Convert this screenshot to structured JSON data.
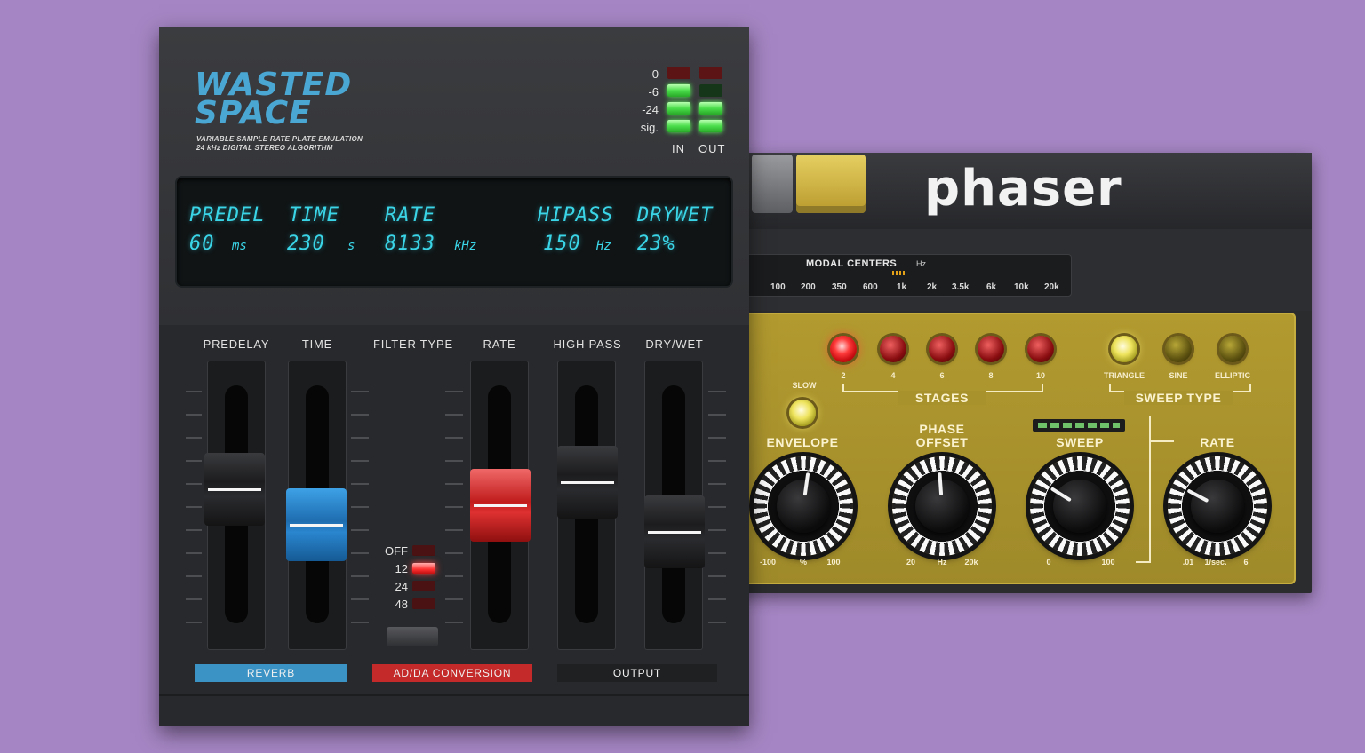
{
  "phaser": {
    "title": "phaser",
    "modal_centers": {
      "title": "MODAL CENTERS",
      "unit": "Hz",
      "freqs": [
        "100",
        "200",
        "350",
        "600",
        "1k",
        "2k",
        "3.5k",
        "6k",
        "10k",
        "20k"
      ]
    },
    "stages": {
      "label": "STAGES",
      "options": [
        "2",
        "4",
        "6",
        "8",
        "10"
      ],
      "selected": "2"
    },
    "sweep_type": {
      "label": "SWEEP TYPE",
      "options": [
        "TRIANGLE",
        "SINE",
        "ELLIPTIC"
      ],
      "selected": "TRIANGLE"
    },
    "slow_label": "SLOW",
    "envelope": {
      "label": "ENVELOPE",
      "min": "-100",
      "unit": "%",
      "max": "100"
    },
    "phase_offset": {
      "label_1": "PHASE",
      "label_2": "OFFSET",
      "min": "20",
      "unit": "Hz",
      "max": "20k"
    },
    "sweep": {
      "label": "SWEEP",
      "min": "0",
      "max": "100"
    },
    "rate": {
      "label": "RATE",
      "min": ".01",
      "unit": "1/sec.",
      "max": "6"
    }
  },
  "wasted_space": {
    "logo_line1": "WASTED",
    "logo_line2": "SPACE",
    "subtitle_1": "VARIABLE SAMPLE RATE PLATE EMULATION",
    "subtitle_2": "24 kHz DIGITAL STEREO ALGORITHM",
    "meter": {
      "levels": [
        "0",
        "-6",
        "-24",
        "sig."
      ],
      "in_label": "IN",
      "out_label": "OUT"
    },
    "display": {
      "headers": [
        "PREDEL",
        "TIME",
        "RATE",
        "HIPASS",
        "DRYWET"
      ],
      "values": [
        {
          "value": "60",
          "unit": "ms"
        },
        {
          "value": "230",
          "unit": "s"
        },
        {
          "value": "8133",
          "unit": "kHz"
        },
        {
          "value": "150",
          "unit": "Hz"
        },
        {
          "value": "23%",
          "unit": ""
        }
      ]
    },
    "sliders": {
      "predelay": "PREDELAY",
      "time": "TIME",
      "filter_type": "FILTER TYPE",
      "rate": "RATE",
      "high_pass": "HIGH PASS",
      "dry_wet": "DRY/WET"
    },
    "filter_options": [
      "OFF",
      "12",
      "24",
      "48"
    ],
    "filter_selected": "12",
    "sections": {
      "reverb": "REVERB",
      "adda": "AD/DA CONVERSION",
      "output": "OUTPUT"
    },
    "colors": {
      "reverb": "#3a93c4",
      "adda": "#c42a2a",
      "output": "#1f2022"
    }
  }
}
